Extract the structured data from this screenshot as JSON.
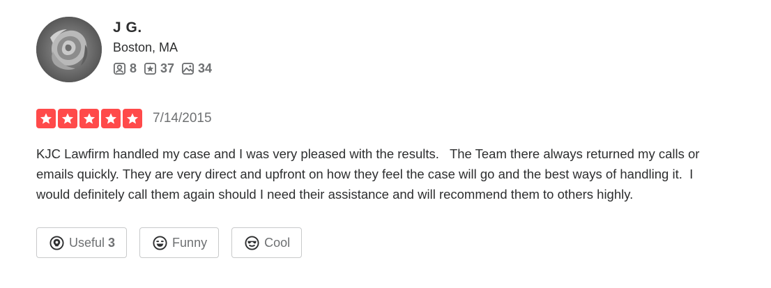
{
  "user": {
    "name": "J G.",
    "location": "Boston, MA",
    "stats": {
      "friends": "8",
      "reviews": "37",
      "photos": "34"
    },
    "avatar_icon": "rose-photo"
  },
  "review": {
    "rating": 5,
    "max_rating": 5,
    "star_color": "#ff4a4a",
    "date": "7/14/2015",
    "text": "KJC Lawfirm handled my case and I was very pleased with the results.   The Team there always returned my calls or emails quickly. They are very direct and upfront on how they feel the case will go and the best ways of handling it.  I would definitely call them again should I need their assistance and will recommend them to others highly."
  },
  "reactions": {
    "useful": {
      "label": "Useful",
      "count": "3"
    },
    "funny": {
      "label": "Funny"
    },
    "cool": {
      "label": "Cool"
    }
  }
}
